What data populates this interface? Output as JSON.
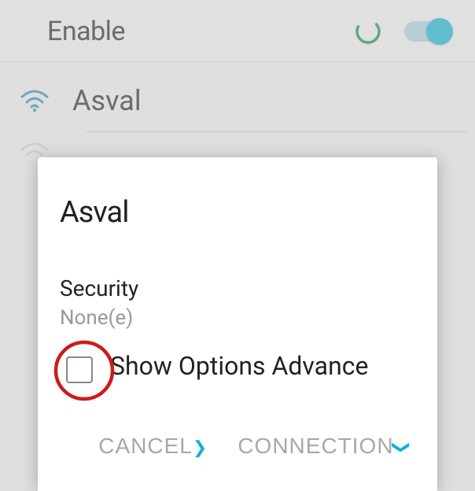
{
  "header": {
    "title": "Enable",
    "toggle_on": true
  },
  "wifi_networks": [
    {
      "name": "Asval",
      "signal": "strong"
    }
  ],
  "dialog": {
    "title": "Asval",
    "security_label": "Security",
    "security_value": "None(e)",
    "show_advanced_label": "Show Options Advance",
    "show_advanced_checked": false,
    "cancel_label": "CANCEL",
    "connect_label": "CONNECTION"
  },
  "colors": {
    "accent": "#0bb5d6",
    "annotation": "#cc1b1b"
  }
}
